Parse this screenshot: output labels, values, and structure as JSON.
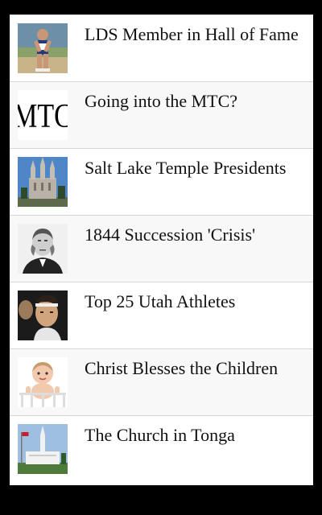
{
  "articles": [
    {
      "title": "LDS Member in Hall of Fame",
      "thumb": "runner-photo"
    },
    {
      "title": "Going into the MTC?",
      "thumb": "mtc-logo",
      "thumb_text": "MTC"
    },
    {
      "title": "Salt Lake Temple Presidents",
      "thumb": "temple-photo"
    },
    {
      "title": "1844 Succession 'Crisis'",
      "thumb": "portrait-engraving"
    },
    {
      "title": "Top 25 Utah Athletes",
      "thumb": "athlete-photo"
    },
    {
      "title": "Christ Blesses the Children",
      "thumb": "baby-photo"
    },
    {
      "title": "The Church in Tonga",
      "thumb": "tonga-temple-photo"
    }
  ]
}
